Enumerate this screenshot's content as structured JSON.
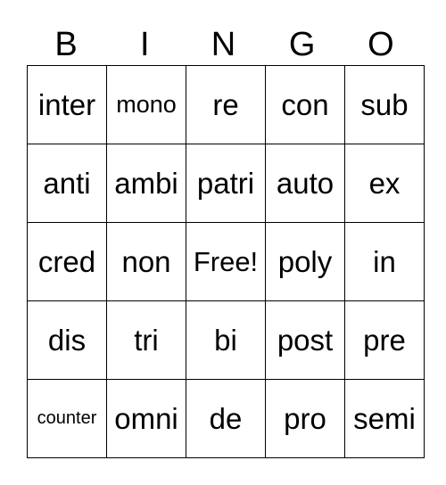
{
  "header": [
    "B",
    "I",
    "N",
    "G",
    "O"
  ],
  "rows": [
    [
      "inter",
      "mono",
      "re",
      "con",
      "sub"
    ],
    [
      "anti",
      "ambi",
      "patri",
      "auto",
      "ex"
    ],
    [
      "cred",
      "non",
      "Free!",
      "poly",
      "in"
    ],
    [
      "dis",
      "tri",
      "bi",
      "post",
      "pre"
    ],
    [
      "counter",
      "omni",
      "de",
      "pro",
      "semi"
    ]
  ]
}
